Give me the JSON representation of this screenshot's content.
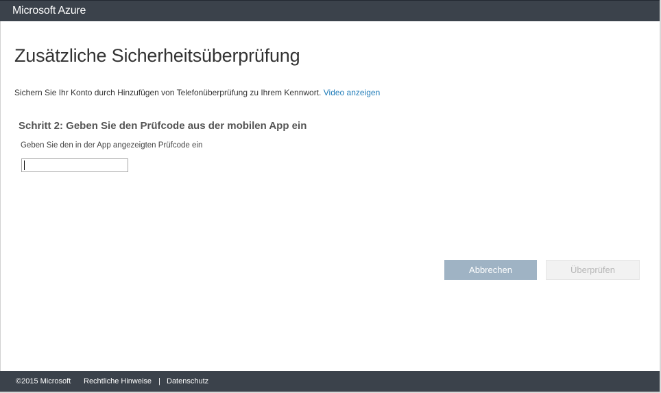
{
  "header": {
    "brand": "Microsoft Azure"
  },
  "main": {
    "title": "Zusätzliche Sicherheitsüberprüfung",
    "intro_text": "Sichern Sie Ihr Konto durch Hinzufügen von Telefonüberprüfung zu Ihrem Kennwort.",
    "intro_link": "Video anzeigen",
    "step_title": "Schritt 2: Geben Sie den Prüfcode aus der mobilen App ein",
    "field_label": "Geben Sie den in der App angezeigten Prüfcode ein",
    "field_value": ""
  },
  "actions": {
    "cancel_label": "Abbrechen",
    "verify_label": "Überprüfen"
  },
  "footer": {
    "copyright": "©2015 Microsoft",
    "legal": "Rechtliche Hinweise",
    "separator": "|",
    "privacy": "Datenschutz"
  },
  "colors": {
    "header_bg": "#3b424b",
    "link": "#1e7bb8",
    "cancel_bg": "#9fb3c4",
    "verify_bg": "#f2f2f2"
  }
}
